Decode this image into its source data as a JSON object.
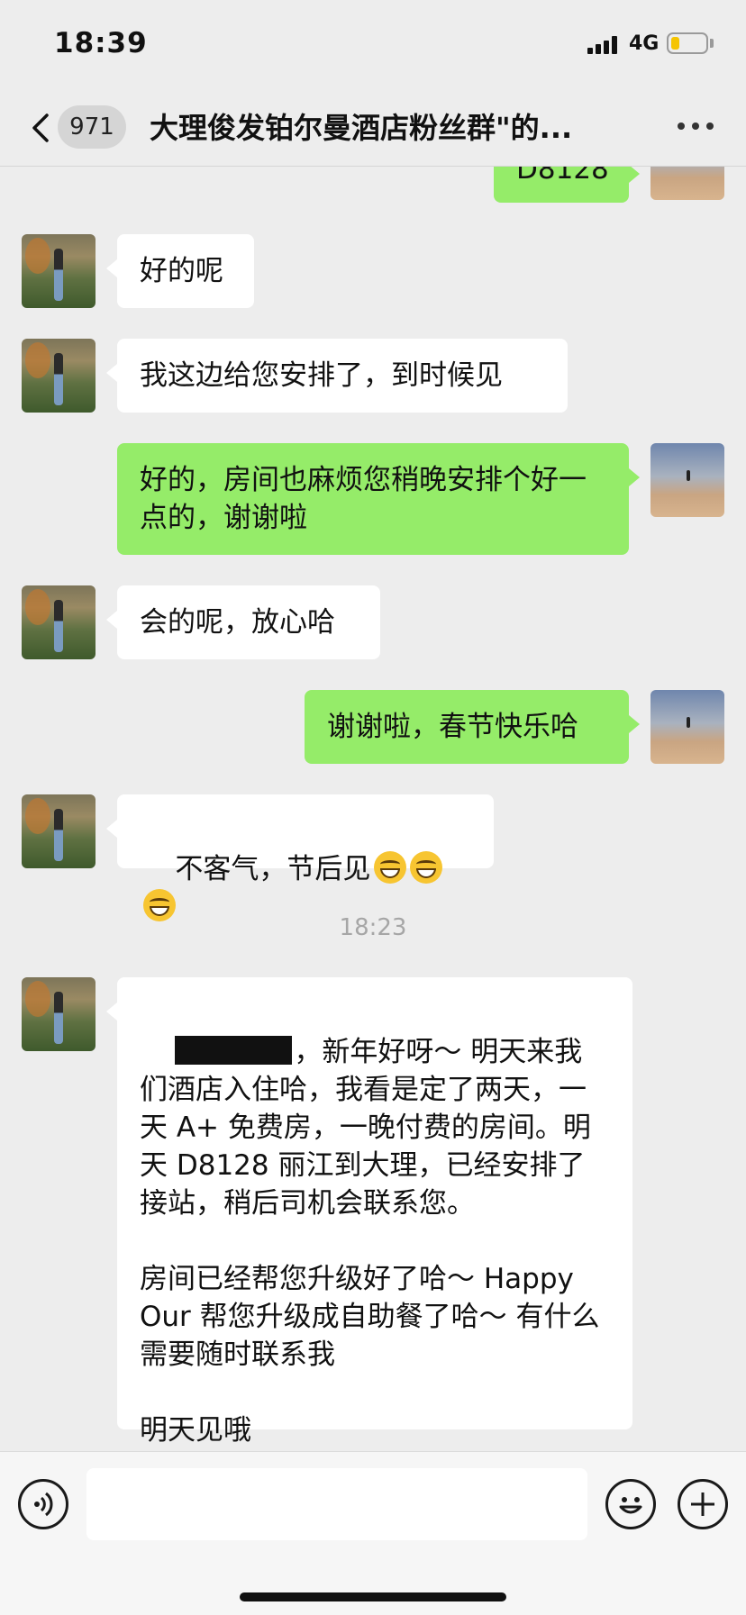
{
  "status_bar": {
    "time": "18:39",
    "network": "4G",
    "battery_level": 0.25,
    "battery_color": "#f5c400"
  },
  "nav": {
    "unread_count": "971",
    "title": "大理俊发铂尔曼酒店粉丝群\"的..."
  },
  "messages": [
    {
      "from": "self",
      "text": "D8128"
    },
    {
      "from": "other",
      "text": "好的呢"
    },
    {
      "from": "other",
      "text": "我这边给您安排了，到时候见"
    },
    {
      "from": "self",
      "text": "好的，房间也麻烦您稍晚安排个好一点的，谢谢啦"
    },
    {
      "from": "other",
      "text": "会的呢，放心哈"
    },
    {
      "from": "self",
      "text": "谢谢啦，春节快乐哈"
    },
    {
      "from": "other",
      "text": "不客气，节后见",
      "emoji": [
        "grin-emoji",
        "grin-emoji",
        "grin-emoji"
      ]
    },
    {
      "type": "timestamp",
      "text": "18:23"
    },
    {
      "from": "other",
      "text": "，新年好呀～ 明天来我们酒店入住哈，我看是定了两天，一天 A+ 免费房，一晚付费的房间。明天 D8128 丽江到大理，已经安排了接站，稍后司机会联系您。\n\n房间已经帮您升级好了哈～ Happy Our 帮您升级成自助餐了哈～ 有什么需要随时联系我\n\n明天见哦"
    }
  ],
  "colors": {
    "bubble_out": "#95ec69",
    "bubble_in": "#ffffff",
    "background": "#ededed"
  },
  "input_bar": {
    "value": "",
    "icons": [
      "voice-icon",
      "emoji-icon",
      "plus-icon"
    ]
  }
}
